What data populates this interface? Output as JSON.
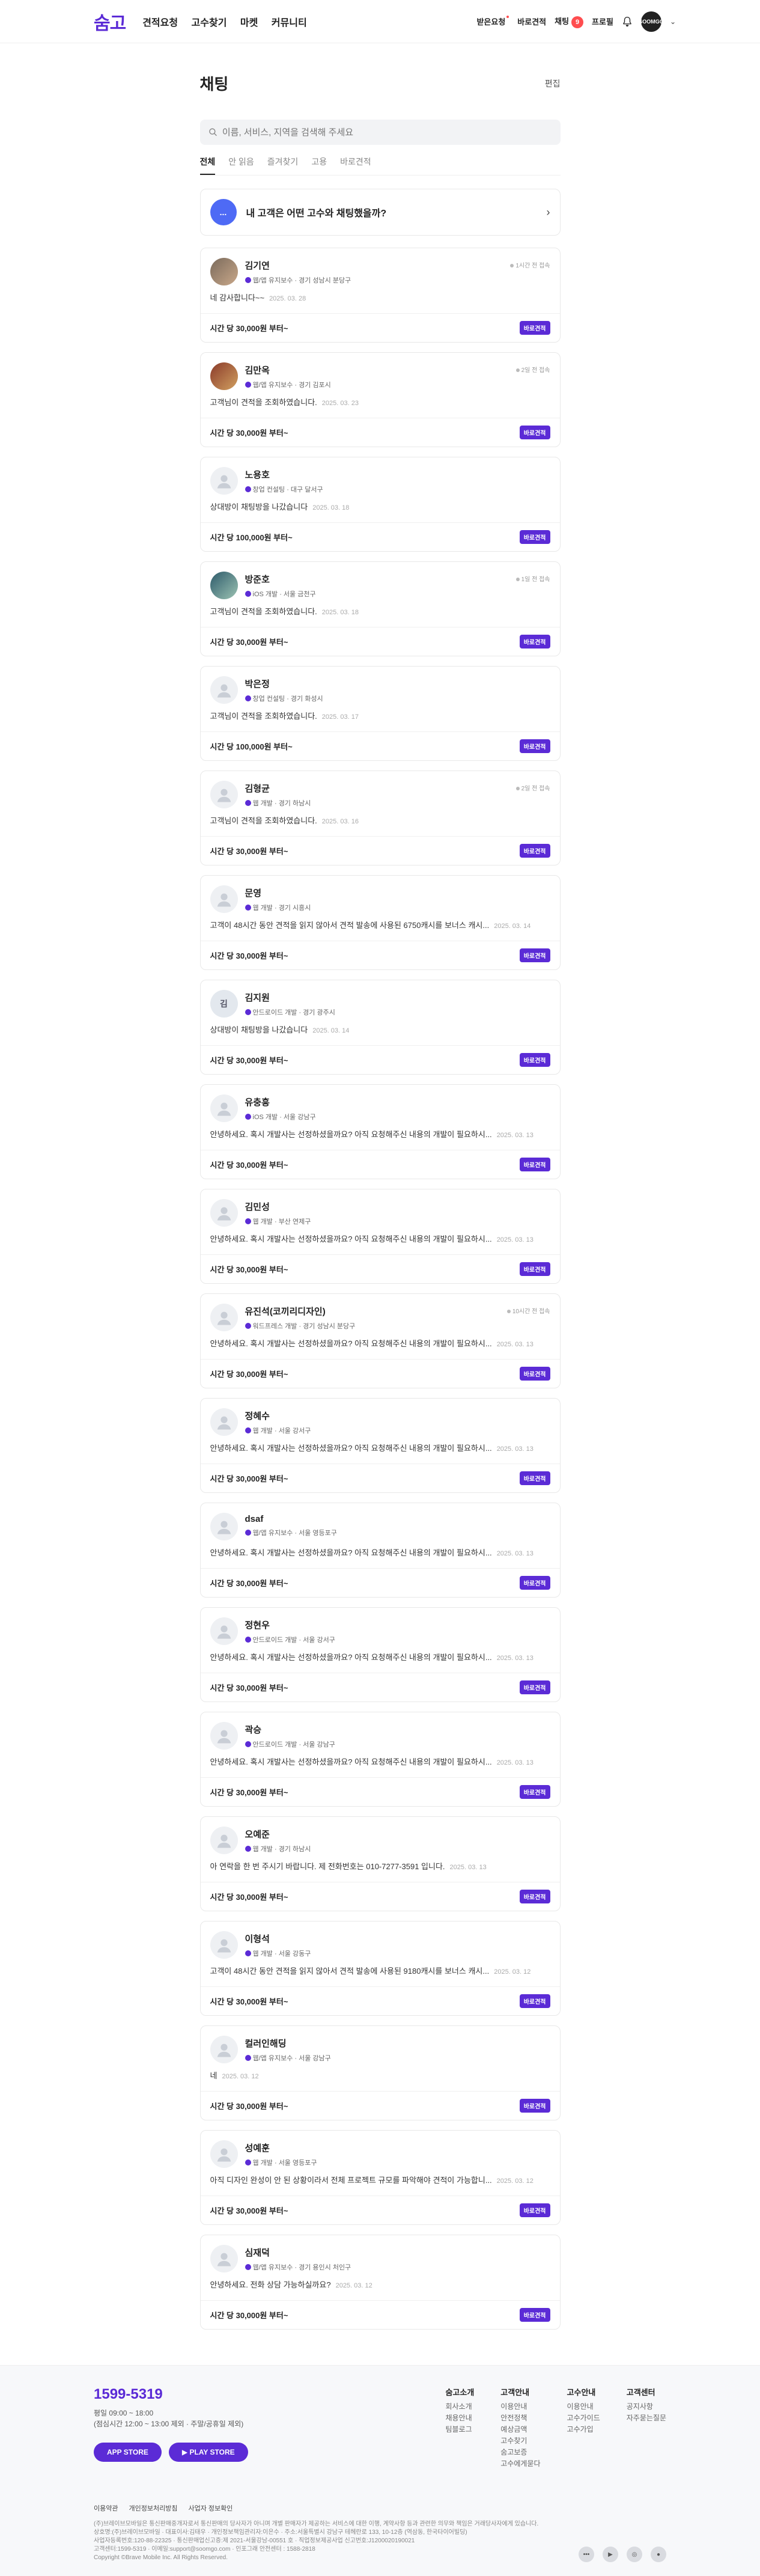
{
  "header": {
    "logo": "숨고",
    "nav": [
      "견적요청",
      "고수찾기",
      "마켓",
      "커뮤니티"
    ],
    "right": {
      "received": "받은요청",
      "quick_quote": "바로견적",
      "chat": "채팅",
      "chat_badge": "9",
      "profile": "프로필",
      "avatar_text": "SOOMGO"
    }
  },
  "page": {
    "title": "채팅",
    "edit": "편집"
  },
  "search": {
    "placeholder": "이름, 서비스, 지역을 검색해 주세요"
  },
  "tabs": [
    "전체",
    "안 읽음",
    "즐겨찾기",
    "고용",
    "바로견적"
  ],
  "banner": {
    "icon_text": "...",
    "text": "내 고객은 어떤 고수와 채팅했을까?"
  },
  "chats": [
    {
      "name": "김기연",
      "service": "웹/앱 유지보수 · 경기 성남시 분당구",
      "online": "1시간 전 접속",
      "message": "네 감사합니다~~",
      "date": "2025. 03. 28",
      "price": "시간 당 30,000원 부터~",
      "tag": "바로견적",
      "pic": "photo"
    },
    {
      "name": "김만옥",
      "service": "웹/앱 유지보수 · 경기 김포시",
      "online": "2일 전 접속",
      "message": "고객님이 견적을 조회하였습니다.",
      "date": "2025. 03. 23",
      "price": "시간 당 30,000원 부터~",
      "tag": "바로견적",
      "pic": "photo2"
    },
    {
      "name": "노용호",
      "service": "창업 컨설팅 · 대구 달서구",
      "online": "",
      "message": "상대방이 채팅방을 나갔습니다",
      "date": "2025. 03. 18",
      "price": "시간 당 100,000원 부터~",
      "tag": "바로견적",
      "pic": "default"
    },
    {
      "name": "방준호",
      "service": "iOS 개발 · 서울 금천구",
      "online": "1일 전 접속",
      "message": "고객님이 견적을 조회하였습니다.",
      "date": "2025. 03. 18",
      "price": "시간 당 30,000원 부터~",
      "tag": "바로견적",
      "pic": "photo3"
    },
    {
      "name": "박은정",
      "service": "창업 컨설팅 · 경기 화성시",
      "online": "",
      "message": "고객님이 견적을 조회하였습니다.",
      "date": "2025. 03. 17",
      "price": "시간 당 100,000원 부터~",
      "tag": "바로견적",
      "pic": "default"
    },
    {
      "name": "김형균",
      "service": "웹 개발 · 경기 하남시",
      "online": "2일 전 접속",
      "message": "고객님이 견적을 조회하였습니다.",
      "date": "2025. 03. 16",
      "price": "시간 당 30,000원 부터~",
      "tag": "바로견적",
      "pic": "default"
    },
    {
      "name": "문영",
      "service": "웹 개발 · 경기 시흥시",
      "online": "",
      "message": "고객이 48시간 동안 견적을 읽지 않아서 견적 발송에 사용된 6750캐시를 보너스 캐시...",
      "date": "2025. 03. 14",
      "price": "시간 당 30,000원 부터~",
      "tag": "바로견적",
      "pic": "default"
    },
    {
      "name": "김지원",
      "service": "안드로이드 개발 · 경기 광주시",
      "online": "",
      "message": "상대방이 채팅방을 나갔습니다",
      "date": "2025. 03. 14",
      "price": "시간 당 30,000원 부터~",
      "tag": "바로견적",
      "pic": "letter",
      "letter": "김"
    },
    {
      "name": "유충흥",
      "service": "iOS 개발 · 서울 강남구",
      "online": "",
      "message": "안녕하세요. 혹시 개발사는 선정하셨을까요? 아직 요청해주신 내용의 개발이 필요하시...",
      "date": "2025. 03. 13",
      "price": "시간 당 30,000원 부터~",
      "tag": "바로견적",
      "pic": "default"
    },
    {
      "name": "김민성",
      "service": "웹 개발 · 부산 연제구",
      "online": "",
      "message": "안녕하세요. 혹시 개발사는 선정하셨을까요? 아직 요청해주신 내용의 개발이 필요하시...",
      "date": "2025. 03. 13",
      "price": "시간 당 30,000원 부터~",
      "tag": "바로견적",
      "pic": "default"
    },
    {
      "name": "유진석(코끼리디자인)",
      "service": "워드프레스 개발 · 경기 성남시 분당구",
      "online": "10시간 전 접속",
      "message": "안녕하세요. 혹시 개발사는 선정하셨을까요? 아직 요청해주신 내용의 개발이 필요하시...",
      "date": "2025. 03. 13",
      "price": "시간 당 30,000원 부터~",
      "tag": "바로견적",
      "pic": "default"
    },
    {
      "name": "정혜수",
      "service": "웹 개발 · 서울 강서구",
      "online": "",
      "message": "안녕하세요. 혹시 개발사는 선정하셨을까요? 아직 요청해주신 내용의 개발이 필요하시...",
      "date": "2025. 03. 13",
      "price": "시간 당 30,000원 부터~",
      "tag": "바로견적",
      "pic": "default"
    },
    {
      "name": "dsaf",
      "service": "웹/앱 유지보수 · 서울 영등포구",
      "online": "",
      "message": "안녕하세요. 혹시 개발사는 선정하셨을까요? 아직 요청해주신 내용의 개발이 필요하시...",
      "date": "2025. 03. 13",
      "price": "시간 당 30,000원 부터~",
      "tag": "바로견적",
      "pic": "default"
    },
    {
      "name": "정현우",
      "service": "안드로이드 개발 · 서울 강서구",
      "online": "",
      "message": "안녕하세요. 혹시 개발사는 선정하셨을까요? 아직 요청해주신 내용의 개발이 필요하시...",
      "date": "2025. 03. 13",
      "price": "시간 당 30,000원 부터~",
      "tag": "바로견적",
      "pic": "default"
    },
    {
      "name": "곽승",
      "service": "안드로이드 개발 · 서울 강남구",
      "online": "",
      "message": "안녕하세요. 혹시 개발사는 선정하셨을까요? 아직 요청해주신 내용의 개발이 필요하시...",
      "date": "2025. 03. 13",
      "price": "시간 당 30,000원 부터~",
      "tag": "바로견적",
      "pic": "default"
    },
    {
      "name": "오예준",
      "service": "웹 개발 · 경기 하남시",
      "online": "",
      "message": "아 연락을 한 번 주시기 바랍니다. 제 전화번호는 010-7277-3591 입니다.",
      "date": "2025. 03. 13",
      "price": "시간 당 30,000원 부터~",
      "tag": "바로견적",
      "pic": "default"
    },
    {
      "name": "이형석",
      "service": "웹 개발 · 서울 강동구",
      "online": "",
      "message": "고객이 48시간 동안 견적을 읽지 않아서 견적 발송에 사용된 9180캐시를 보너스 캐시...",
      "date": "2025. 03. 12",
      "price": "시간 당 30,000원 부터~",
      "tag": "바로견적",
      "pic": "default"
    },
    {
      "name": "컬러인해딩",
      "service": "웹/앱 유지보수 · 서울 강남구",
      "online": "",
      "message": "네",
      "date": "2025. 03. 12",
      "price": "시간 당 30,000원 부터~",
      "tag": "바로견적",
      "pic": "default"
    },
    {
      "name": "성예훈",
      "service": "웹 개발 · 서울 영등포구",
      "online": "",
      "message": "아직 디자인 완성이 안 된 상황이라서 전체 프로젝트 규모를 파악해야 견적이 가능합니...",
      "date": "2025. 03. 12",
      "price": "시간 당 30,000원 부터~",
      "tag": "바로견적",
      "pic": "default"
    },
    {
      "name": "심재덕",
      "service": "웹/앱 유지보수 · 경기 용인시 처인구",
      "online": "",
      "message": "안녕하세요. 전화 상담 가능하실까요?",
      "date": "2025. 03. 12",
      "price": "시간 당 30,000원 부터~",
      "tag": "바로견적",
      "pic": "default"
    }
  ],
  "footer": {
    "phone": "1599-5319",
    "hours1": "평일 09:00 ~ 18:00",
    "hours2": "(점심시간 12:00 ~ 13:00 제외 · 주말/공휴일 제외)",
    "app_store": "APP STORE",
    "play_store": "PLAY STORE",
    "cols": [
      {
        "title": "숨고소개",
        "items": [
          "회사소개",
          "채용안내",
          "팀블로그"
        ]
      },
      {
        "title": "고객안내",
        "items": [
          "이용안내",
          "안전정책",
          "예상금액",
          "고수찾기",
          "숨고보증",
          "고수에게묻다"
        ]
      },
      {
        "title": "고수안내",
        "items": [
          "이용안내",
          "고수가이드",
          "고수가입"
        ]
      },
      {
        "title": "고객센터",
        "items": [
          "공지사항",
          "자주묻는질문"
        ]
      }
    ],
    "links": [
      "이용약관",
      "개인정보처리방침",
      "사업자 정보확인"
    ],
    "legal1": "(주)브레이브모바일은 통신판매중개자로서 통신판매의 당사자가 아니며 개별 판매자가 제공하는 서비스에 대한 이행, 계약사항 등과 관련한 의무와 책임은 거래당사자에게 있습니다.",
    "legal2": "상호명:(주)브레이브모바일 · 대표이사:김태우 · 개인정보책임관리자:이은수 · 주소:서울특별시 강남구 테헤란로 133, 10-12층 (역삼동, 한국타이어빌딩)",
    "legal3": "사업자등록번호:120-88-22325 · 통신판매업신고증:제 2021-서울강남-00551 호 · 직업정보제공사업 신고번호:J1200020190021",
    "legal4": "고객센터:1599-5319 · 이메일:support@soomgo.com · 인포그래 안전센터 : 1588-2818",
    "copyright": "Copyright ©Brave Mobile Inc. All Rights Reserved.",
    "social": [
      "blog",
      "youtube",
      "instagram",
      "kakao"
    ]
  }
}
